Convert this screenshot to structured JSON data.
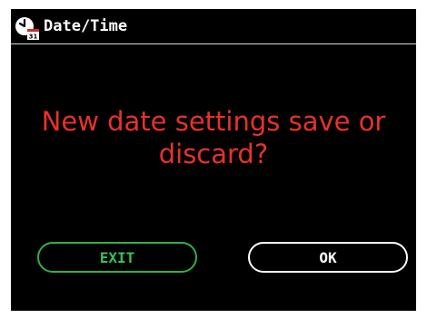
{
  "header": {
    "title": "Date/Time",
    "icon": "clock-calendar-icon",
    "icon_badge": "31"
  },
  "dialog": {
    "message": "New date settings save or discard?",
    "buttons": {
      "exit_label": "EXIT",
      "ok_label": "OK"
    }
  },
  "colors": {
    "background": "#000000",
    "message": "#e8312a",
    "exit_accent": "#2fb14a",
    "ok_accent": "#ffffff"
  }
}
